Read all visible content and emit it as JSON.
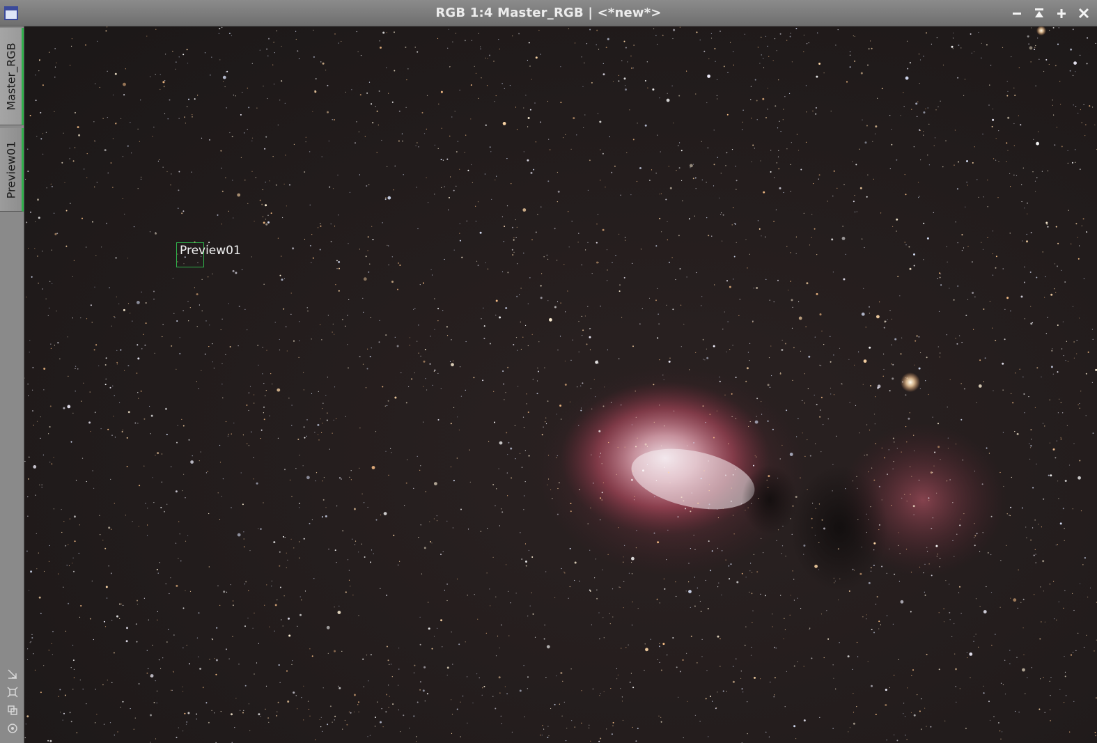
{
  "window": {
    "title": "RGB 1:4 Master_RGB | <*new*>",
    "icon": "image-window-icon",
    "controls": [
      {
        "name": "minimize-button",
        "icon": "minus-icon"
      },
      {
        "name": "shade-button",
        "icon": "shade-up-icon"
      },
      {
        "name": "maximize-button",
        "icon": "plus-icon"
      },
      {
        "name": "close-button",
        "icon": "close-icon"
      }
    ]
  },
  "tabs": [
    {
      "label": "Master_RGB",
      "active": false
    },
    {
      "label": "Preview01",
      "active": true
    }
  ],
  "side_tools": [
    {
      "name": "fit-view-icon"
    },
    {
      "name": "zoom-to-fit-icon"
    },
    {
      "name": "clone-view-icon"
    },
    {
      "name": "target-icon"
    }
  ],
  "image": {
    "subject": "Star field with emission nebula",
    "preview_label": "Preview01"
  },
  "colors": {
    "accent": "#2fb04a",
    "titlebar": "#7a7a7a",
    "sky": "#1f1a1a",
    "nebula": "#c5596b"
  }
}
